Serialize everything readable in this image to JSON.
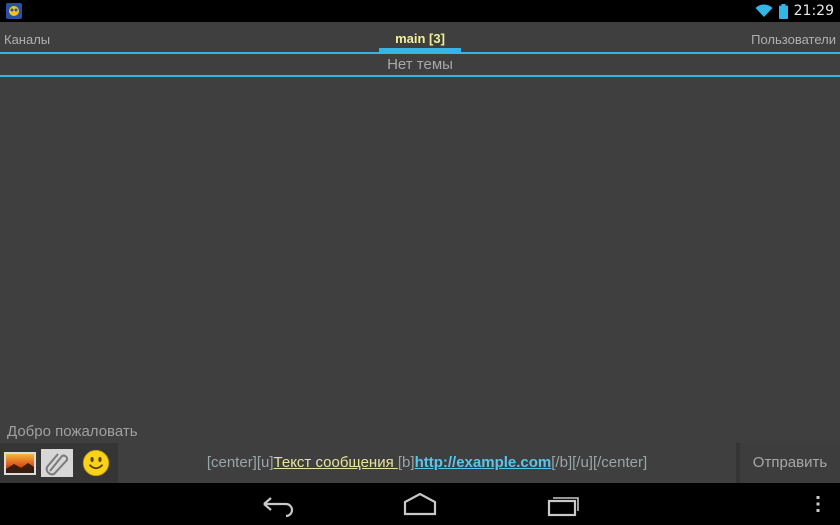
{
  "status_bar": {
    "time": "21:29",
    "icons": [
      "app-icon",
      "wifi-icon",
      "battery-icon"
    ]
  },
  "tabs": {
    "left_label": "Каналы",
    "center_label": "main [3]",
    "right_label": "Пользователи"
  },
  "topic": "Нет темы",
  "chat": {
    "welcome_message": "Добро пожаловать"
  },
  "composer": {
    "tools": [
      "photo-icon",
      "attach-paperclip-icon",
      "smiley-icon"
    ],
    "input": {
      "tag_open": "[center][u]",
      "text": "Текст сообщения ",
      "tag_mid": "[b]",
      "link": "http://example.com",
      "tag_close": "[/b][/u][/center]"
    },
    "send_label": "Отправить"
  },
  "navigation": {
    "buttons": [
      "back-icon",
      "home-icon",
      "recent-apps-icon",
      "overflow-menu-icon"
    ]
  },
  "colors": {
    "accent": "#33b5e5",
    "tab_active_text": "#f2ef9a",
    "link": "#57c7ee",
    "background": "#3f3f3f"
  }
}
